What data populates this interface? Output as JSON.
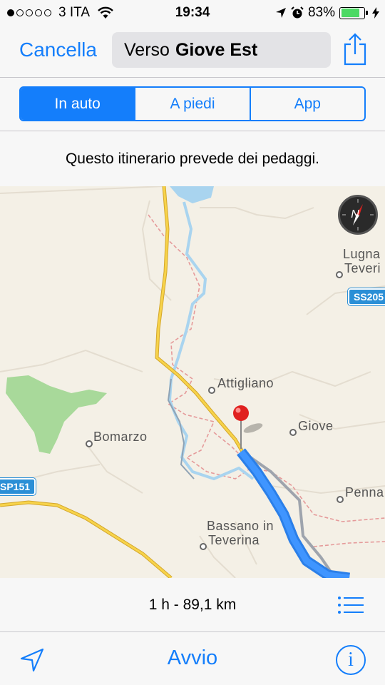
{
  "status_bar": {
    "carrier": "3 ITA",
    "signal_bars_filled": 1,
    "signal_bars_total": 5,
    "time": "19:34",
    "battery": "83%",
    "battery_level": 0.83,
    "icons": [
      "wifi-icon",
      "location-arrow-icon",
      "alarm-icon",
      "battery-icon",
      "charging-bolt-icon"
    ]
  },
  "nav": {
    "cancel_label": "Cancella",
    "destination_prefix": "Verso",
    "destination_name": "Giove Est"
  },
  "transport_modes": [
    "In auto",
    "A piedi",
    "App"
  ],
  "selected_mode": "In auto",
  "notice": "Questo itinerario prevede dei pedaggi.",
  "map": {
    "places": [
      "Attigliano",
      "Giove",
      "Bomarzo",
      "Bassano in",
      "Teverina",
      "Lugna",
      "Teveri",
      "Penna"
    ],
    "road_shields": [
      "SS205",
      "SP151"
    ],
    "compass_label": "N",
    "colors": {
      "route": "#2b7fe8",
      "highway": "#f1c232",
      "water": "#a9d4ef",
      "park": "#a8d99a",
      "land": "#f4f0e6"
    }
  },
  "summary": {
    "duration_distance": "1 h - 89,1 km"
  },
  "toolbar": {
    "start_label": "Avvio",
    "info_label": "i"
  }
}
